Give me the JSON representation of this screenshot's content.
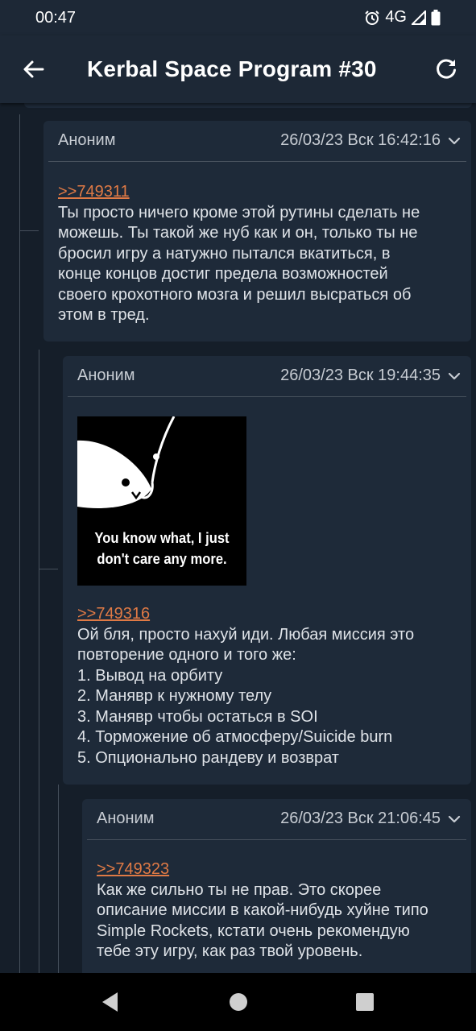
{
  "status_bar": {
    "time": "00:47",
    "network": "4G",
    "icons": [
      "alarm-icon",
      "signal-icon",
      "battery-icon"
    ]
  },
  "app_bar": {
    "title": "Kerbal Space Program #30",
    "back_icon": "arrow-left-icon",
    "refresh_icon": "refresh-icon"
  },
  "posts": [
    {
      "author": "Аноним",
      "date": "26/03/23 Вск 16:42:16",
      "reply_to": ">>749311",
      "lines": [
        "Ты просто ничего кроме этой рутины сделать не",
        "можешь. Ты такой же нуб как и он, только ты не",
        "бросил игру а натужно пытался вкатиться, в",
        "конце концов достиг предела возможностей",
        "своего крохотного мозга и решил высраться об",
        "этом в тред."
      ]
    },
    {
      "author": "Аноним",
      "date": "26/03/23 Вск 19:44:35",
      "image_caption_line1": "You know what, I just",
      "image_caption_line2": "don't care any more.",
      "reply_to": ">>749316",
      "lines": [
        "Ой бля, просто нахуй иди. Любая миссия это",
        "повторение одного и того же:",
        "1. Вывод на орбиту",
        "2. Манявр к нужному телу",
        "3. Манявр чтобы остаться в SOI",
        "4. Торможение об атмосферу/Suicide burn",
        "5. Опционально рандеву и возврат"
      ]
    },
    {
      "author": "Аноним",
      "date": "26/03/23 Вск 21:06:45",
      "reply_to": ">>749323",
      "lines": [
        "Как же сильно ты не прав. Это скорее",
        "описание миссии в какой-нибудь хуйне типо",
        "Simple Rockets, кстати очень рекомендую",
        "тебе эту игру, как раз твой уровень."
      ]
    }
  ],
  "nav_bar": {
    "icons": [
      "back-triangle-icon",
      "home-circle-icon",
      "recents-square-icon"
    ]
  },
  "colors": {
    "background": "#151e29",
    "card": "#1e2a39",
    "bar": "#1d2836",
    "link": "#e07a45",
    "text": "#dfe3e8"
  }
}
